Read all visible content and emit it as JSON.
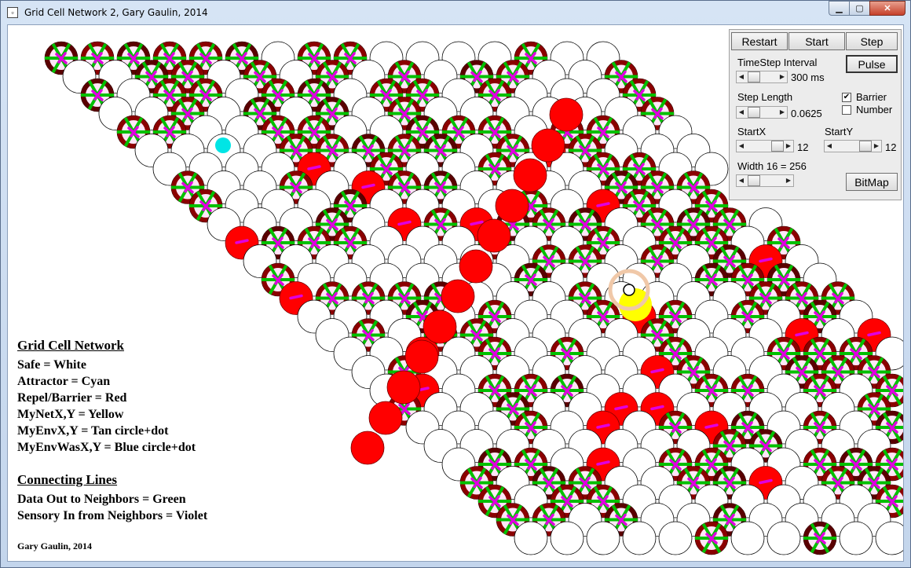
{
  "window": {
    "title": "Grid Cell Network 2, Gary Gaulin, 2014",
    "app_icon": "app-icon"
  },
  "controls": {
    "restart_label": "Restart",
    "start_label": "Start",
    "step_label": "Step",
    "pulse_label": "Pulse",
    "bitmap_label": "BitMap",
    "timestep_label": "TimeStep Interval",
    "timestep_value": "300 ms",
    "steplength_label": "Step Length",
    "steplength_value": "0.0625",
    "barrier_label": "Barrier",
    "barrier_checked": true,
    "number_label": "Number",
    "number_checked": false,
    "startx_label": "StartX",
    "startx_value": "12",
    "starty_label": "StartY",
    "starty_value": "12",
    "width_label": "Width 16 = 256"
  },
  "legend": {
    "title": "Grid Cell Network",
    "items": [
      "Safe = White",
      "Attractor = Cyan",
      "Repel/Barrier = Red",
      "MyNetX,Y = Yellow",
      "MyEnvX,Y = Tan circle+dot",
      "MyEnvWasX,Y = Blue circle+dot"
    ],
    "lines_title": "Connecting Lines",
    "lines_items": [
      "Data Out to Neighbors = Green",
      "Sensory In from Neighbors = Violet"
    ],
    "credit": "Gary Gaulin, 2014"
  },
  "colors": {
    "safe": "#ffffff",
    "attractor": "#00e5e5",
    "barrier": "#ff0000",
    "place_ring": "#8b0000",
    "data_out": "#00c000",
    "sensory_in": "#e000e0",
    "my_net": "#ffff00",
    "my_env": "#f0c8a8"
  }
}
